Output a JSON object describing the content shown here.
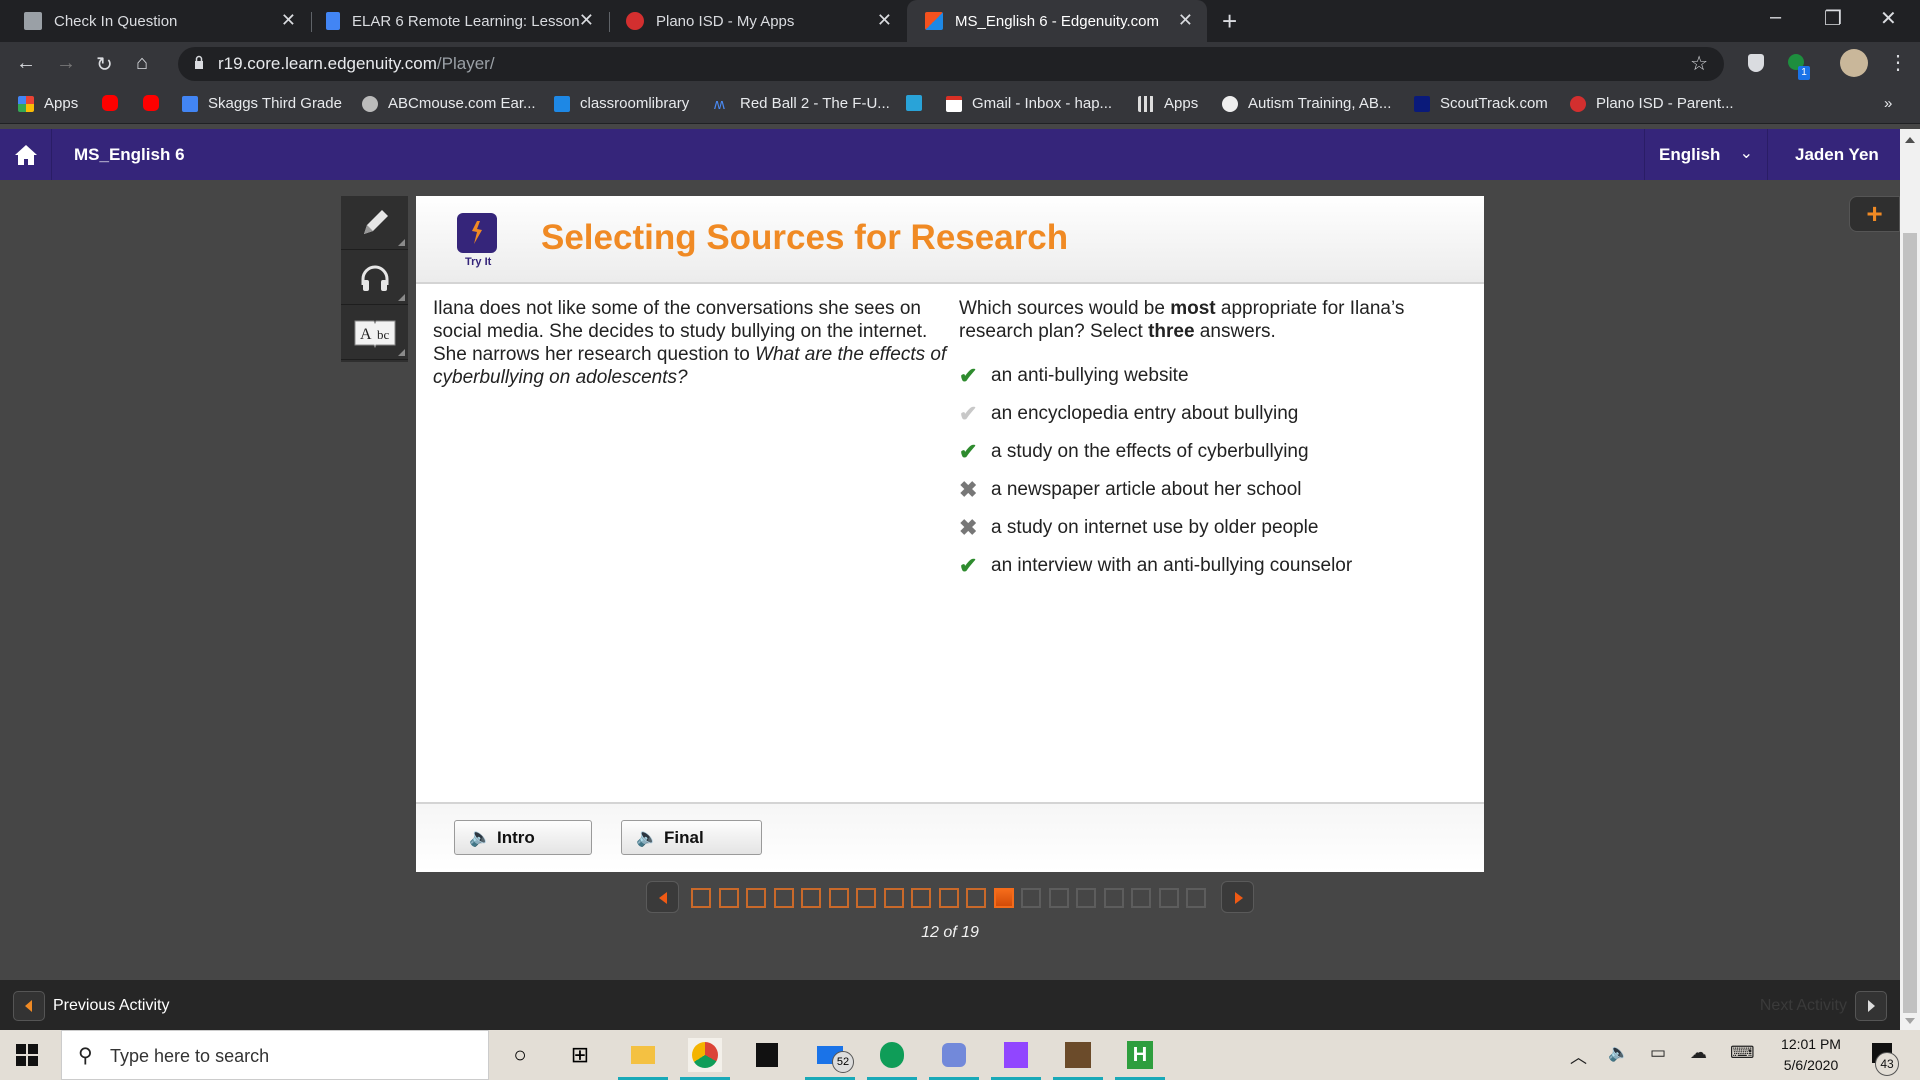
{
  "browser": {
    "tabs": [
      {
        "title": "Check In Question",
        "icon": "form-icon",
        "active": false
      },
      {
        "title": "ELAR 6 Remote Learning: Lesson",
        "icon": "google-docs-icon",
        "active": false
      },
      {
        "title": "Plano ISD - My Apps",
        "icon": "plano-isd-icon",
        "active": false
      },
      {
        "title": "MS_English 6 - Edgenuity.com",
        "icon": "edgenuity-icon",
        "active": true
      }
    ],
    "new_tab": "+",
    "close_glyph": "✕",
    "window": {
      "minimize": "–",
      "maximize": "❐",
      "close": "✕"
    },
    "url_host": "r19.core.learn.edgenuity.com",
    "url_path": "/Player/",
    "extension_badge": "1",
    "bookmarks": [
      {
        "label": "Apps",
        "icon": "apps-grid-icon"
      },
      {
        "label": "",
        "icon": "youtube-icon"
      },
      {
        "label": "",
        "icon": "youtube-icon"
      },
      {
        "label": "Skaggs Third Grade",
        "icon": "site-icon"
      },
      {
        "label": "ABCmouse.com Ear...",
        "icon": "abcmouse-icon"
      },
      {
        "label": "classroomlibrary",
        "icon": "classroomlibrary-icon"
      },
      {
        "label": "Red Ball 2 - The F-U...",
        "icon": "redball-icon"
      },
      {
        "label": "",
        "icon": "cloud-icon"
      },
      {
        "label": "Gmail - Inbox - hap...",
        "icon": "gmail-icon"
      },
      {
        "label": "Apps",
        "icon": "apps-grid-icon"
      },
      {
        "label": "Autism Training, AB...",
        "icon": "globe-icon"
      },
      {
        "label": "ScoutTrack.com",
        "icon": "scouttrack-icon"
      },
      {
        "label": "Plano ISD - Parent...",
        "icon": "plano-isd-icon"
      }
    ],
    "bookmarks_overflow": "»"
  },
  "app": {
    "course_title": "MS_English 6",
    "language": "English",
    "user_name": "Jaden Yen",
    "brand_color": "#35257a",
    "accent_color": "#f08a24"
  },
  "tools": [
    {
      "name": "pencil-icon"
    },
    {
      "name": "headphones-icon"
    },
    {
      "name": "dictionary-icon"
    }
  ],
  "activity": {
    "badge_label": "Try It",
    "title": "Selecting Sources for Research",
    "passage_plain": "Ilana does not like some of the conversations she sees on social media. She decides to study bullying on the internet. She narrows her research question to ",
    "passage_italic": "What are the effects of cyberbullying on adolescents?",
    "question_parts": {
      "a": "Which sources would be ",
      "b_bold": "most",
      "c": " appropriate for Ilana’s research plan? Select ",
      "d_bold": "three",
      "e": " answers."
    },
    "answers": [
      {
        "text": "an anti-bullying website",
        "status": "correct",
        "mark": "✔"
      },
      {
        "text": "an encyclopedia entry about bullying",
        "status": "missed",
        "mark": "✔"
      },
      {
        "text": "a study on the effects of cyberbullying",
        "status": "correct",
        "mark": "✔"
      },
      {
        "text": "a newspaper article about her school",
        "status": "wrong",
        "mark": "✖"
      },
      {
        "text": "a study on internet use by older people",
        "status": "wrong",
        "mark": "✖"
      },
      {
        "text": "an interview with an anti-bullying counselor",
        "status": "correct",
        "mark": "✔"
      }
    ],
    "audio_buttons": [
      {
        "label": "Intro"
      },
      {
        "label": "Final"
      }
    ]
  },
  "pagination": {
    "current": 12,
    "total": 19,
    "label": "12 of 19"
  },
  "activity_nav": {
    "previous": "Previous Activity",
    "next": "Next Activity"
  },
  "taskbar": {
    "search_placeholder": "Type here to search",
    "mail_badge": "52",
    "time": "12:01 PM",
    "date": "5/6/2020",
    "notifications": "43",
    "apps": [
      "cortana-icon",
      "task-view-icon",
      "file-explorer-icon",
      "chrome-icon",
      "store-icon",
      "mail-icon",
      "hangouts-icon",
      "discord-icon",
      "twitch-icon",
      "minecraft-icon",
      "hulu-icon"
    ]
  }
}
